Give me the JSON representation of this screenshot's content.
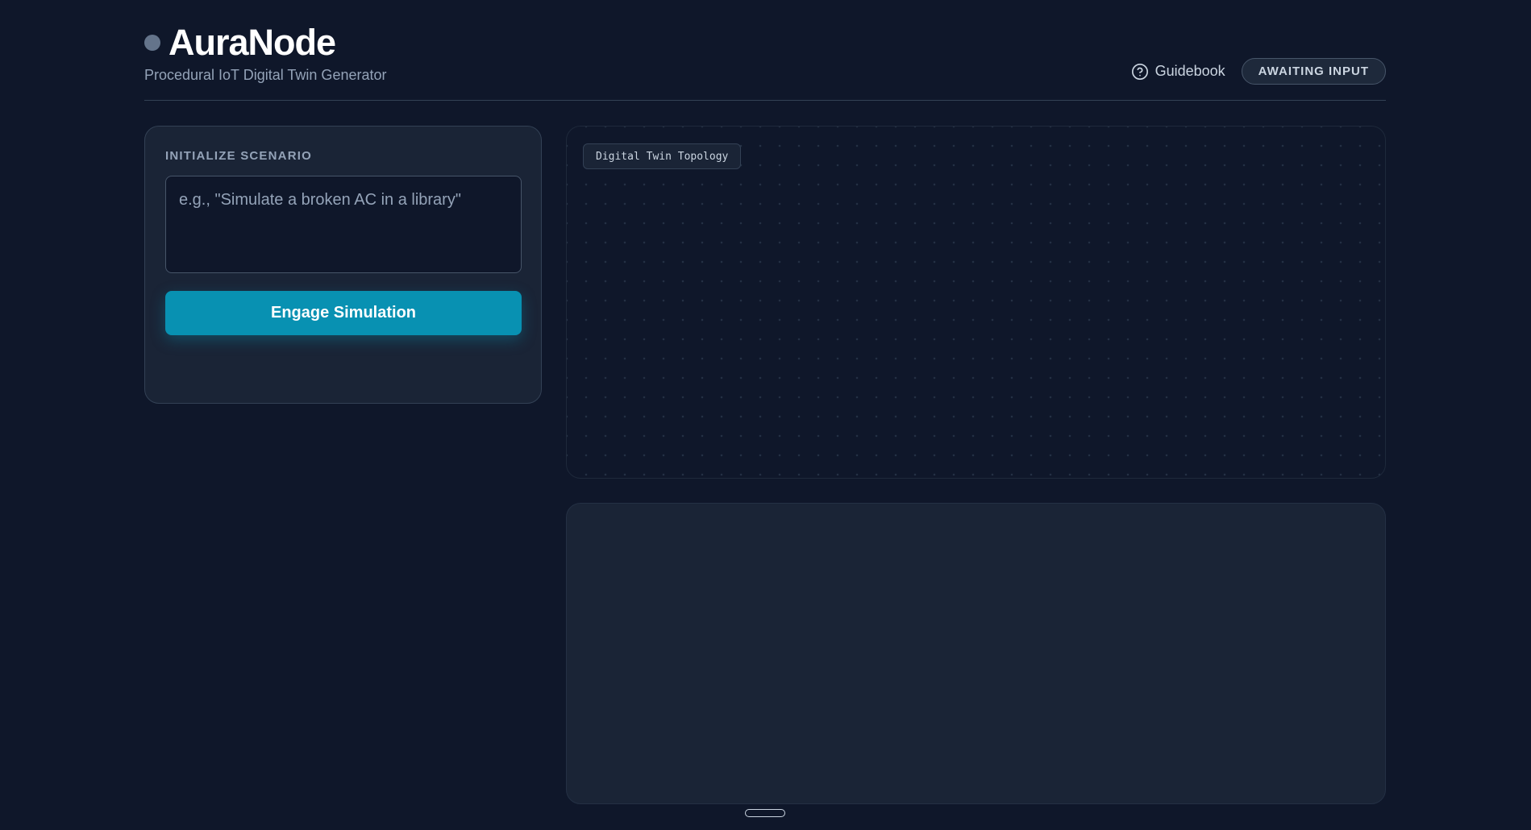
{
  "app": {
    "title": "AuraNode",
    "subtitle": "Procedural IoT Digital Twin Generator",
    "status_dot_color": "#64748b"
  },
  "header": {
    "guide_icon": "help-circle-icon",
    "guide_label": "Guidebook",
    "status_label": "AWAITING INPUT"
  },
  "scenario": {
    "label": "INITIALIZE SCENARIO",
    "input_value": "",
    "input_placeholder": "e.g., \"Simulate a broken AC in a library\"",
    "engage_label": "Engage Simulation",
    "accent_color": "#0891b2"
  },
  "topology": {
    "badge_label": "Digital Twin Topology"
  },
  "output": {}
}
